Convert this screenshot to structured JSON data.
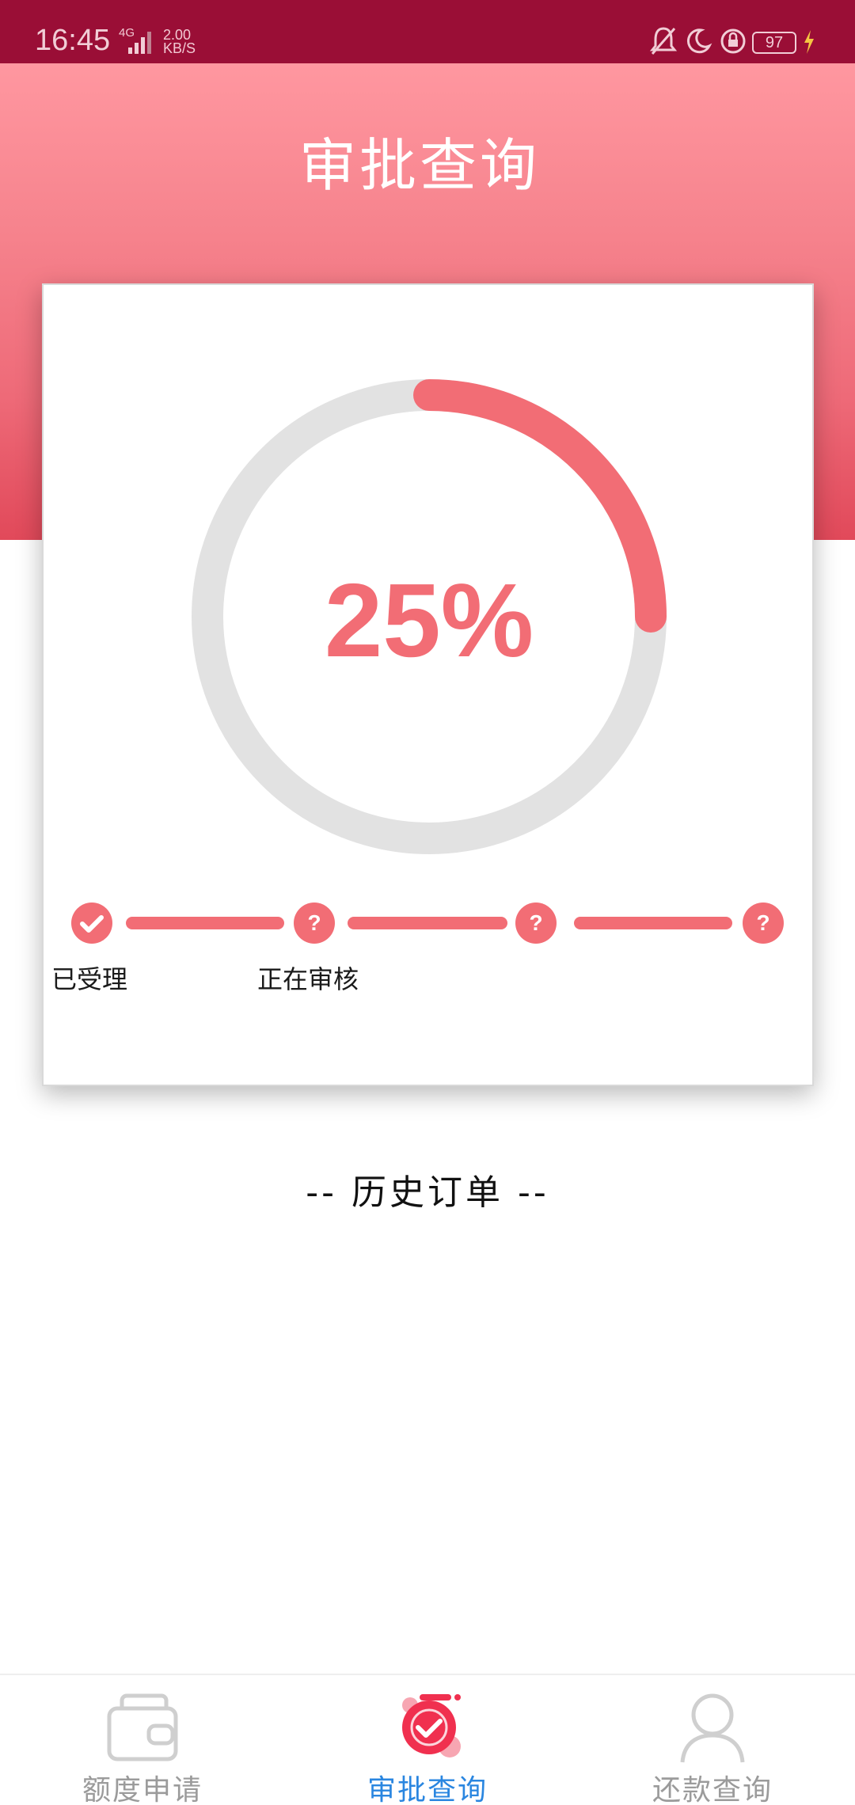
{
  "status_bar": {
    "time": "16:45",
    "network": "4G",
    "speed_value": "2.00",
    "speed_unit": "KB/S",
    "battery": "97"
  },
  "header": {
    "title": "审批查询"
  },
  "progress": {
    "percent_label": "25%",
    "fraction": 0.25,
    "color": "#f26d75",
    "track_color": "#e2e2e2"
  },
  "steps": [
    {
      "state": "done",
      "icon": "check-icon",
      "label": "已受理"
    },
    {
      "state": "pending",
      "icon": "question-icon",
      "symbol": "?",
      "label": "正在审核"
    },
    {
      "state": "pending",
      "icon": "question-icon",
      "symbol": "?",
      "label": ""
    },
    {
      "state": "pending",
      "icon": "question-icon",
      "symbol": "?",
      "label": ""
    }
  ],
  "history": {
    "title": "-- 历史订单 --"
  },
  "tabbar": {
    "items": [
      {
        "label": "额度申请",
        "icon": "wallet-icon",
        "active": false
      },
      {
        "label": "审批查询",
        "icon": "approval-check-icon",
        "active": true
      },
      {
        "label": "还款查询",
        "icon": "user-icon",
        "active": false
      }
    ],
    "active_color": "#2a86e0",
    "inactive_color": "#9b9b9b"
  }
}
